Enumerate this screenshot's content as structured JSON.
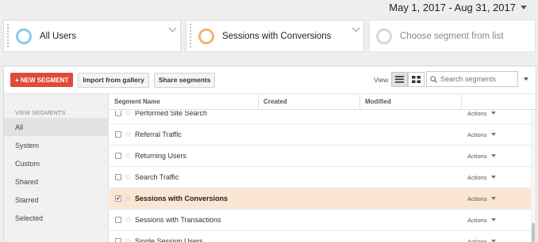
{
  "date_range": "May 1, 2017 - Aug 31, 2017",
  "segment_bar": {
    "cards": [
      {
        "label": "All Users",
        "color": "#8ec9ec"
      },
      {
        "label": "Sessions with Conversions",
        "color": "#f2b46d"
      },
      {
        "label": "Choose segment from list",
        "color": "#d8d8d8"
      }
    ]
  },
  "toolbar": {
    "new_segment": "+ NEW SEGMENT",
    "import": "Import from gallery",
    "share": "Share segments",
    "view_label": "View",
    "search_placeholder": "Search segments"
  },
  "sidebar": {
    "heading": "VIEW SEGMENTS",
    "items": [
      "All",
      "System",
      "Custom",
      "Shared",
      "Starred",
      "Selected"
    ],
    "active": "All"
  },
  "table": {
    "columns": [
      "Segment Name",
      "Created",
      "Modified"
    ],
    "rows": [
      {
        "name": "Performed Site Search",
        "checked": false,
        "action": "Actions"
      },
      {
        "name": "Referral Traffic",
        "checked": false,
        "action": "Actions"
      },
      {
        "name": "Returning Users",
        "checked": false,
        "action": "Actions"
      },
      {
        "name": "Search Traffic",
        "checked": false,
        "action": "Actions"
      },
      {
        "name": "Sessions with Conversions",
        "checked": true,
        "action": "Actions"
      },
      {
        "name": "Sessions with Transactions",
        "checked": false,
        "action": "Actions"
      },
      {
        "name": "Single Session Users",
        "checked": false,
        "action": "Actions"
      }
    ]
  },
  "colors": {
    "accent_red": "#dd4b39",
    "highlight_row": "#fbe5d3"
  }
}
